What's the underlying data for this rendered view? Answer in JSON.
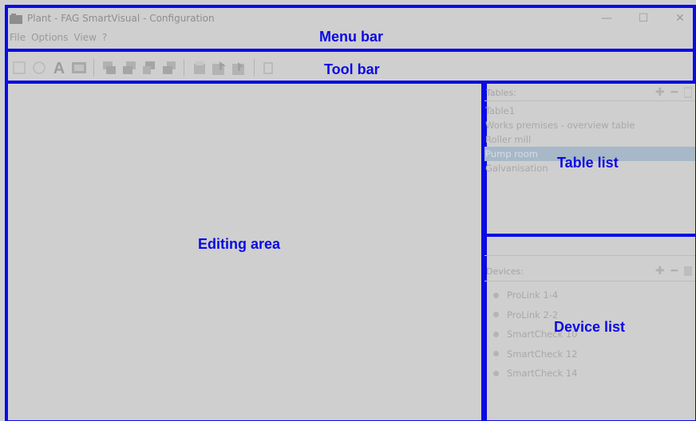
{
  "window": {
    "title": "Plant - FAG SmartVisual - Configuration",
    "min_glyph": "—",
    "max_glyph": "☐",
    "close_glyph": "✕"
  },
  "menu": [
    "File",
    "Options",
    "View",
    "?"
  ],
  "labels": {
    "menu_bar": "Menu bar",
    "tool_bar": "Tool bar",
    "editing_area": "Editing area",
    "table_list": "Table list",
    "device_list": "Device list"
  },
  "tables": {
    "header": "Tables:",
    "items": [
      "Table1",
      "Works premises - overview table",
      "Roller mill",
      "Pump room",
      "Galvanisation"
    ],
    "selected_index": 3
  },
  "devices": {
    "header": "Devices:",
    "items": [
      "ProLink 1-4",
      "ProLink 2-2",
      "SmartCheck 10",
      "SmartCheck 12",
      "SmartCheck 14"
    ]
  },
  "toolbar": {
    "buttons": [
      "rectangle-tool",
      "circle-tool",
      "text-tool",
      "image-tool",
      "align-tool-1",
      "align-tool-2",
      "align-tool-3",
      "align-tool-4",
      "open-table-tool",
      "import-tool",
      "export-tool",
      "copy-tool"
    ]
  }
}
